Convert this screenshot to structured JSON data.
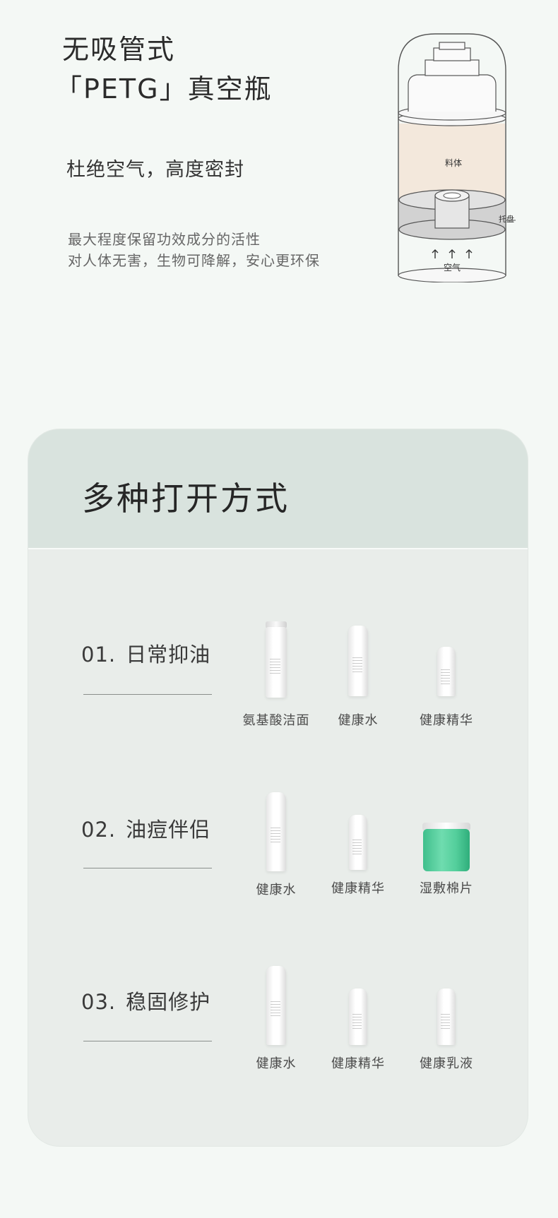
{
  "hero": {
    "title_line1": "无吸管式",
    "title_line2": "「PETG」真空瓶",
    "subtitle": "杜绝空气，高度密封",
    "desc_line1": "最大程度保留功效成分的活性",
    "desc_line2": "对人体无害，生物可降解，安心更环保",
    "diagram": {
      "liquid_label": "料体",
      "tray_label": "托盘",
      "air_label": "空气"
    }
  },
  "section": {
    "title": "多种打开方式",
    "groups": [
      {
        "num": "01.",
        "label": "日常抑油",
        "products": [
          {
            "name": "氨基酸洁面",
            "icon": "foam-pump-bottle-icon"
          },
          {
            "name": "健康水",
            "icon": "tall-bottle-icon"
          },
          {
            "name": "健康精华",
            "icon": "short-bottle-icon"
          }
        ]
      },
      {
        "num": "02.",
        "label": "油痘伴侣",
        "products": [
          {
            "name": "健康水",
            "icon": "tall-bottle-icon"
          },
          {
            "name": "健康精华",
            "icon": "short-bottle-icon"
          },
          {
            "name": "湿敷棉片",
            "icon": "green-jar-icon"
          }
        ]
      },
      {
        "num": "03.",
        "label": "稳固修护",
        "products": [
          {
            "name": "健康水",
            "icon": "tall-bottle-icon"
          },
          {
            "name": "健康精华",
            "icon": "short-bottle-icon"
          },
          {
            "name": "健康乳液",
            "icon": "short-bottle-icon"
          }
        ]
      }
    ]
  },
  "colors": {
    "background": "#f4f8f5",
    "card": "#e9edea",
    "card_header": "#d9e3de",
    "liquid": "#f3e8dc",
    "jar": "#4ccc98"
  }
}
